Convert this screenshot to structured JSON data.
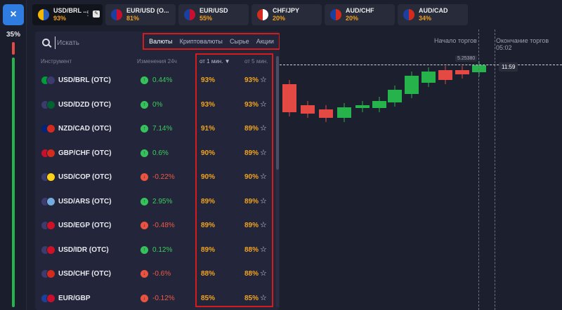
{
  "sidebar": {
    "close_label": "×",
    "percent": "35%"
  },
  "tabs": [
    {
      "name": "USD/BRL ...",
      "payout": "93%",
      "active": true,
      "menu": "⋮",
      "flag": [
        "#f5b800",
        "#2c5fb8"
      ]
    },
    {
      "name": "EUR/USD (O...",
      "payout": "81%",
      "flag": [
        "#1b3f9e",
        "#c8102e"
      ]
    },
    {
      "name": "EUR/USD",
      "payout": "55%",
      "flag": [
        "#1b3f9e",
        "#c8102e"
      ]
    },
    {
      "name": "CHF/JPY",
      "payout": "20%",
      "flag": [
        "#d52b1e",
        "#ffffff"
      ]
    },
    {
      "name": "AUD/CHF",
      "payout": "20%",
      "flag": [
        "#1b3f9e",
        "#d52b1e"
      ]
    },
    {
      "name": "AUD/CAD",
      "payout": "34%",
      "flag": [
        "#1b3f9e",
        "#d52b1e"
      ]
    }
  ],
  "search": {
    "placeholder": "Искать"
  },
  "categories": [
    {
      "label": "Валюты",
      "active": true
    },
    {
      "label": "Криптовалюты"
    },
    {
      "label": "Сырье"
    },
    {
      "label": "Акции"
    }
  ],
  "table": {
    "headers": {
      "instrument": "Инструмент",
      "change": "Изменения 24ч",
      "one_min": "от 1 мин. ▼",
      "five_min": "от 5 мин."
    },
    "rows": [
      {
        "name": "USD/BRL (OTC)",
        "change": "0.44%",
        "dir": "up",
        "p1": "93%",
        "p5": "93%",
        "flag": [
          "#009b3a",
          "#3c3b6e"
        ]
      },
      {
        "name": "USD/DZD (OTC)",
        "change": "0%",
        "dir": "up",
        "p1": "93%",
        "p5": "93%",
        "flag": [
          "#3c3b6e",
          "#006233"
        ]
      },
      {
        "name": "NZD/CAD (OTC)",
        "change": "7.14%",
        "dir": "up",
        "p1": "91%",
        "p5": "89%",
        "flag": [
          "#00247d",
          "#d52b1e"
        ]
      },
      {
        "name": "GBP/CHF (OTC)",
        "change": "0.6%",
        "dir": "up",
        "p1": "90%",
        "p5": "89%",
        "flag": [
          "#c8102e",
          "#d52b1e"
        ]
      },
      {
        "name": "USD/COP (OTC)",
        "change": "-0.22%",
        "dir": "down",
        "p1": "90%",
        "p5": "90%",
        "flag": [
          "#3c3b6e",
          "#fcd116"
        ]
      },
      {
        "name": "USD/ARS (OTC)",
        "change": "2.95%",
        "dir": "up",
        "p1": "89%",
        "p5": "89%",
        "flag": [
          "#3c3b6e",
          "#74acdf"
        ]
      },
      {
        "name": "USD/EGP (OTC)",
        "change": "-0.48%",
        "dir": "down",
        "p1": "89%",
        "p5": "89%",
        "flag": [
          "#3c3b6e",
          "#ce1126"
        ]
      },
      {
        "name": "USD/IDR (OTC)",
        "change": "0.12%",
        "dir": "up",
        "p1": "89%",
        "p5": "88%",
        "flag": [
          "#3c3b6e",
          "#ce1126"
        ]
      },
      {
        "name": "USD/CHF (OTC)",
        "change": "-0.6%",
        "dir": "down",
        "p1": "88%",
        "p5": "88%",
        "flag": [
          "#3c3b6e",
          "#d52b1e"
        ]
      },
      {
        "name": "EUR/GBP",
        "change": "-0.12%",
        "dir": "down",
        "p1": "85%",
        "p5": "85%",
        "flag": [
          "#1b3f9e",
          "#c8102e"
        ]
      }
    ]
  },
  "chart": {
    "trade_start": "Начало торгов",
    "trade_end": "Окончание торгов",
    "end_time": "05:02",
    "price": "5.25380",
    "time_tag": "11:59"
  },
  "colors": {
    "up": "#26b34b",
    "down": "#e44a43",
    "payout": "#f2a41f",
    "highlight": "#d61b1b",
    "accent": "#2f7de1"
  }
}
